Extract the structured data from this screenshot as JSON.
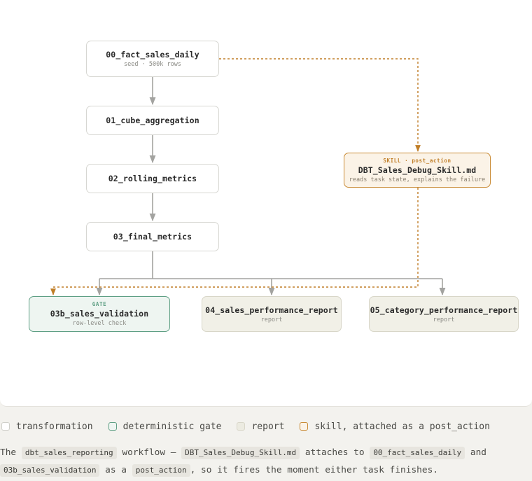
{
  "nodes": {
    "fact": {
      "title": "00_fact_sales_daily",
      "sub": "seed · 500k rows"
    },
    "cube": {
      "title": "01_cube_aggregation"
    },
    "rolling": {
      "title": "02_rolling_metrics"
    },
    "final": {
      "title": "03_final_metrics"
    },
    "gate": {
      "kind": "GATE",
      "title": "03b_sales_validation",
      "sub": "row-level check"
    },
    "report04": {
      "title": "04_sales_performance_report",
      "sub": "report"
    },
    "report05": {
      "title": "05_category_performance_report",
      "sub": "report"
    },
    "skill": {
      "kind": "SKILL · post_action",
      "title": "DBT_Sales_Debug_Skill.md",
      "sub": "reads task state, explains the failure"
    }
  },
  "legend": {
    "transformation": "transformation",
    "gate": "deterministic gate",
    "report": "report",
    "skill": "skill, attached as a post_action"
  },
  "caption": {
    "the": "The",
    "workflow_name": "dbt_sales_reporting",
    "workflow_dash": "workflow —",
    "skill_file": "DBT_Sales_Debug_Skill.md",
    "attaches_to": "attaches to",
    "task_a": "00_fact_sales_daily",
    "and": "and",
    "task_b": "03b_sales_validation",
    "as_a": "as a",
    "post_action": "post_action",
    "tail": ", so it fires the moment either task finishes."
  },
  "colors": {
    "edge": "#a3a3a0",
    "skill_edge": "#c07e28",
    "gate": "#5e9f84",
    "report": "#d8d6c8",
    "skill": "#c98a34"
  }
}
